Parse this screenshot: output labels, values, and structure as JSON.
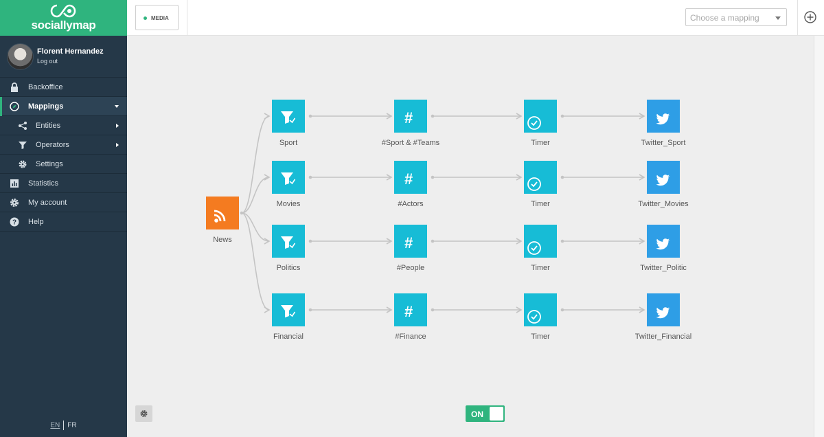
{
  "app": {
    "logo_text": "sociallymap",
    "accent": "#2fb47e"
  },
  "user": {
    "name": "Florent Hernandez",
    "logout": "Log out"
  },
  "nav": {
    "backoffice": "Backoffice",
    "mappings": "Mappings",
    "entities": "Entities",
    "operators": "Operators",
    "settings": "Settings",
    "statistics": "Statistics",
    "my_account": "My account",
    "help": "Help"
  },
  "lang": {
    "en": "EN",
    "fr": "FR"
  },
  "toolbar": {
    "media": "MEDIA",
    "mapping_placeholder": "Choose a mapping"
  },
  "flow": {
    "source": "News",
    "rows": [
      {
        "filter": "Sport",
        "hashtag": "#Sport & #Teams",
        "timer": "Timer",
        "twitter": "Twitter_Sport"
      },
      {
        "filter": "Movies",
        "hashtag": "#Actors",
        "timer": "Timer",
        "twitter": "Twitter_Movies"
      },
      {
        "filter": "Politics",
        "hashtag": "#People",
        "timer": "Timer",
        "twitter": "Twitter_Politic"
      },
      {
        "filter": "Financial",
        "hashtag": "#Finance",
        "timer": "Timer",
        "twitter": "Twitter_Financial"
      }
    ]
  },
  "toggle": {
    "label": "ON"
  },
  "colors": {
    "node_teal": "#17bcd6",
    "node_twitter": "#2e9ee6",
    "node_rss": "#f47b20",
    "sidebar": "#253848"
  },
  "icons": [
    "lock-icon",
    "compass-icon",
    "share-icon",
    "funnel-icon",
    "gear-icon",
    "bar-chart-icon",
    "help-icon",
    "plus-circle-icon",
    "rss-icon",
    "hashtag-icon",
    "clock-icon",
    "twitter-icon"
  ]
}
